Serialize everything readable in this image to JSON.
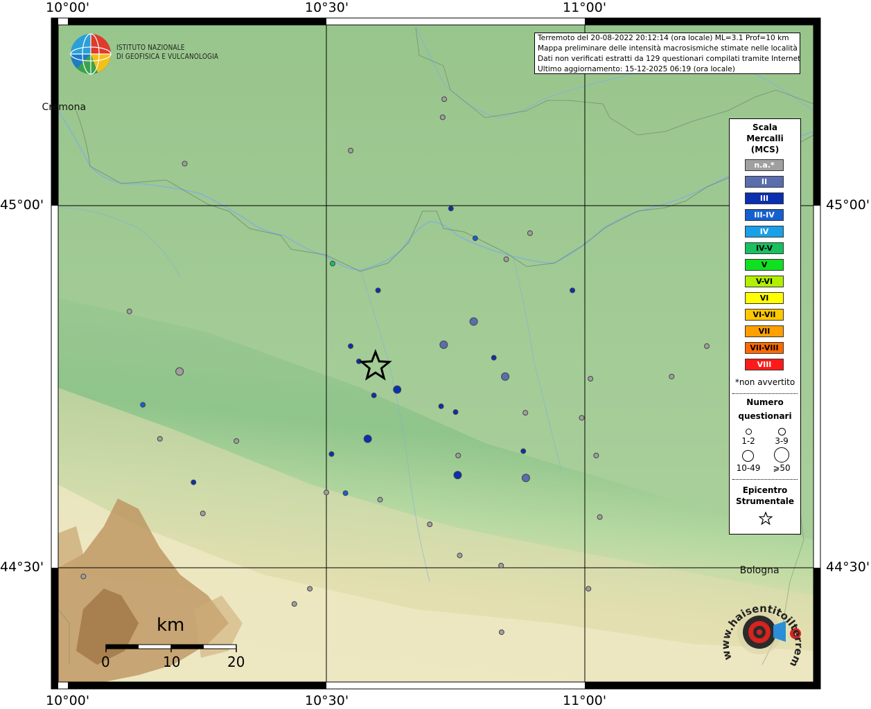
{
  "map": {
    "lon_labels": [
      "10°00'",
      "10°30'",
      "11°00'"
    ],
    "lat_labels": [
      "45°00'",
      "44°30'"
    ],
    "places": [
      {
        "name": "Cremona",
        "lon": 9.99,
        "lat": 45.135
      },
      {
        "name": "Bologna",
        "lon": 11.34,
        "lat": 44.495
      }
    ]
  },
  "institution": {
    "line1": "ISTITUTO NAZIONALE",
    "line2": "DI GEOFISICA E VULCANOLOGIA"
  },
  "info": {
    "line1": "Terremoto del 20-08-2022 20:12:14 (ora locale) ML=3.1 Prof=10 km",
    "line2": "Mappa preliminare delle intensità macrosismiche stimate nelle località",
    "line3": "Dati non verificati estratti da 129 questionari compilati tramite Internet.",
    "line4": "Ultimo aggiornamento: 15-12-2025 06:19 (ora locale)"
  },
  "legend": {
    "title1": "Scala",
    "title2": "Mercalli",
    "title3": "(MCS)",
    "classes": [
      {
        "label": "n.a.*",
        "color": "#a0a0a0",
        "text": "#ffffff"
      },
      {
        "label": "II",
        "color": "#5a6eae",
        "text": "#ffffff"
      },
      {
        "label": "III",
        "color": "#0a2fb0",
        "text": "#ffffff"
      },
      {
        "label": "III-IV",
        "color": "#1560d0",
        "text": "#ffffff"
      },
      {
        "label": "IV",
        "color": "#1aa0e8",
        "text": "#ffffff"
      },
      {
        "label": "IV-V",
        "color": "#18c060",
        "text": "#000000"
      },
      {
        "label": "V",
        "color": "#10e020",
        "text": "#000000"
      },
      {
        "label": "V-VI",
        "color": "#b0f000",
        "text": "#000000"
      },
      {
        "label": "VI",
        "color": "#ffff00",
        "text": "#000000"
      },
      {
        "label": "VI-VII",
        "color": "#ffc800",
        "text": "#000000"
      },
      {
        "label": "VII",
        "color": "#ffa000",
        "text": "#000000"
      },
      {
        "label": "VII-VIII",
        "color": "#ff6a00",
        "text": "#000000"
      },
      {
        "label": "VIII",
        "color": "#ff1a1a",
        "text": "#ffffff"
      }
    ],
    "not_felt": "*non avvertito",
    "count_title1": "Numero",
    "count_title2": "questionari",
    "sizes": [
      "1-2",
      "3-9",
      "10-49",
      "⩾50"
    ],
    "epicenter1": "Epicentro",
    "epicenter2": "Strumentale"
  },
  "scalebar": {
    "unit": "km",
    "labels": [
      "0",
      "10",
      "20"
    ]
  },
  "logo_hsit": {
    "text": "www.haisentitoilterremoto.it"
  },
  "epicenter": {
    "lon": 10.595,
    "lat": 44.778
  },
  "observations": [
    {
      "lon": 10.728,
      "lat": 45.147,
      "mcs": "n.a.*",
      "size": 1
    },
    {
      "lon": 10.725,
      "lat": 45.122,
      "mcs": "n.a.*",
      "size": 1
    },
    {
      "lon": 10.226,
      "lat": 45.058,
      "mcs": "n.a.*",
      "size": 1
    },
    {
      "lon": 10.547,
      "lat": 45.076,
      "mcs": "n.a.*",
      "size": 1
    },
    {
      "lon": 10.741,
      "lat": 44.996,
      "mcs": "III",
      "size": 1
    },
    {
      "lon": 10.512,
      "lat": 44.92,
      "mcs": "IV-V",
      "size": 1
    },
    {
      "lon": 10.894,
      "lat": 44.962,
      "mcs": "n.a.*",
      "size": 1
    },
    {
      "lon": 10.788,
      "lat": 44.955,
      "mcs": "III-IV",
      "size": 1
    },
    {
      "lon": 10.848,
      "lat": 44.926,
      "mcs": "n.a.*",
      "size": 1
    },
    {
      "lon": 10.976,
      "lat": 44.883,
      "mcs": "III",
      "size": 1
    },
    {
      "lon": 10.6,
      "lat": 44.883,
      "mcs": "III",
      "size": 1
    },
    {
      "lon": 10.119,
      "lat": 44.854,
      "mcs": "n.a.*",
      "size": 1
    },
    {
      "lon": 10.785,
      "lat": 44.84,
      "mcs": "II",
      "size": 2
    },
    {
      "lon": 10.727,
      "lat": 44.808,
      "mcs": "II",
      "size": 2
    },
    {
      "lon": 10.547,
      "lat": 44.806,
      "mcs": "III",
      "size": 1
    },
    {
      "lon": 11.236,
      "lat": 44.806,
      "mcs": "n.a.*",
      "size": 1
    },
    {
      "lon": 10.824,
      "lat": 44.79,
      "mcs": "III",
      "size": 1
    },
    {
      "lon": 10.563,
      "lat": 44.785,
      "mcs": "III",
      "size": 1
    },
    {
      "lon": 10.216,
      "lat": 44.771,
      "mcs": "n.a.*",
      "size": 2
    },
    {
      "lon": 10.846,
      "lat": 44.764,
      "mcs": "II",
      "size": 2
    },
    {
      "lon": 11.011,
      "lat": 44.761,
      "mcs": "n.a.*",
      "size": 1
    },
    {
      "lon": 11.168,
      "lat": 44.764,
      "mcs": "n.a.*",
      "size": 1
    },
    {
      "lon": 10.592,
      "lat": 44.738,
      "mcs": "III",
      "size": 1
    },
    {
      "lon": 10.637,
      "lat": 44.746,
      "mcs": "III",
      "size": 2
    },
    {
      "lon": 10.145,
      "lat": 44.725,
      "mcs": "III-IV",
      "size": 1
    },
    {
      "lon": 10.722,
      "lat": 44.723,
      "mcs": "III",
      "size": 1
    },
    {
      "lon": 10.75,
      "lat": 44.715,
      "mcs": "III",
      "size": 1
    },
    {
      "lon": 10.885,
      "lat": 44.714,
      "mcs": "n.a.*",
      "size": 1
    },
    {
      "lon": 10.994,
      "lat": 44.707,
      "mcs": "n.a.*",
      "size": 1
    },
    {
      "lon": 10.178,
      "lat": 44.678,
      "mcs": "n.a.*",
      "size": 1
    },
    {
      "lon": 10.326,
      "lat": 44.675,
      "mcs": "n.a.*",
      "size": 1
    },
    {
      "lon": 10.58,
      "lat": 44.678,
      "mcs": "III",
      "size": 2
    },
    {
      "lon": 10.881,
      "lat": 44.661,
      "mcs": "III",
      "size": 1
    },
    {
      "lon": 10.51,
      "lat": 44.657,
      "mcs": "III",
      "size": 1
    },
    {
      "lon": 10.755,
      "lat": 44.655,
      "mcs": "n.a.*",
      "size": 1
    },
    {
      "lon": 11.022,
      "lat": 44.655,
      "mcs": "n.a.*",
      "size": 1
    },
    {
      "lon": 10.754,
      "lat": 44.628,
      "mcs": "III",
      "size": 2
    },
    {
      "lon": 10.886,
      "lat": 44.624,
      "mcs": "II",
      "size": 2
    },
    {
      "lon": 10.243,
      "lat": 44.618,
      "mcs": "III",
      "size": 1
    },
    {
      "lon": 10.5,
      "lat": 44.604,
      "mcs": "n.a.*",
      "size": 1
    },
    {
      "lon": 10.537,
      "lat": 44.603,
      "mcs": "III-IV",
      "size": 1
    },
    {
      "lon": 10.604,
      "lat": 44.594,
      "mcs": "n.a.*",
      "size": 1
    },
    {
      "lon": 10.261,
      "lat": 44.575,
      "mcs": "n.a.*",
      "size": 1
    },
    {
      "lon": 11.029,
      "lat": 44.57,
      "mcs": "n.a.*",
      "size": 1
    },
    {
      "lon": 10.7,
      "lat": 44.56,
      "mcs": "n.a.*",
      "size": 1
    },
    {
      "lon": 10.758,
      "lat": 44.517,
      "mcs": "n.a.*",
      "size": 1
    },
    {
      "lon": 10.838,
      "lat": 44.503,
      "mcs": "n.a.*",
      "size": 1
    },
    {
      "lon": 10.03,
      "lat": 44.488,
      "mcs": "n.a.*",
      "size": 1
    },
    {
      "lon": 10.468,
      "lat": 44.471,
      "mcs": "n.a.*",
      "size": 1
    },
    {
      "lon": 11.007,
      "lat": 44.471,
      "mcs": "n.a.*",
      "size": 1
    },
    {
      "lon": 10.438,
      "lat": 44.45,
      "mcs": "n.a.*",
      "size": 1
    },
    {
      "lon": 10.839,
      "lat": 44.411,
      "mcs": "n.a.*",
      "size": 1
    }
  ]
}
